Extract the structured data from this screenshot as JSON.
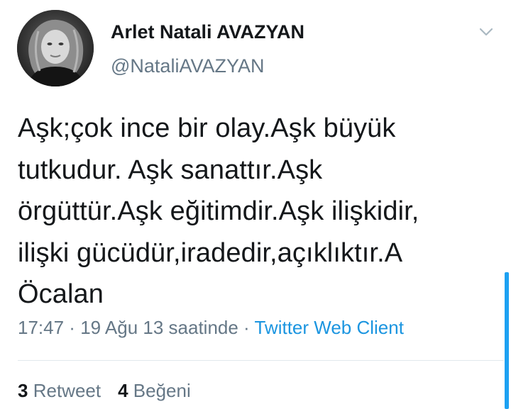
{
  "author": {
    "name": "Arlet Natali AVAZYAN",
    "handle": "@NataliAVAZYAN",
    "avatar_icon": "profile-photo"
  },
  "tweet": {
    "lines": [
      "Aşk;çok ince bir olay.Aşk büyük",
      "tutkudur. Aşk sanattır.Aşk",
      "örgüttür.Aşk eğitimdir.Aşk ilişkidir,",
      "ilişki gücüdür,iradedir,açıklıktır.A",
      "Öcalan"
    ],
    "time": "17:47",
    "separator": " · ",
    "date": "19 Ağu 13 saatinde",
    "source": "Twitter Web Client"
  },
  "stats": {
    "retweets_count": "3",
    "retweets_label": "Retweet",
    "likes_count": "4",
    "likes_label": "Beğeni"
  },
  "colors": {
    "text": "#14171a",
    "secondary": "#657786",
    "link": "#1b95e0",
    "divider": "#e1e8ed"
  }
}
